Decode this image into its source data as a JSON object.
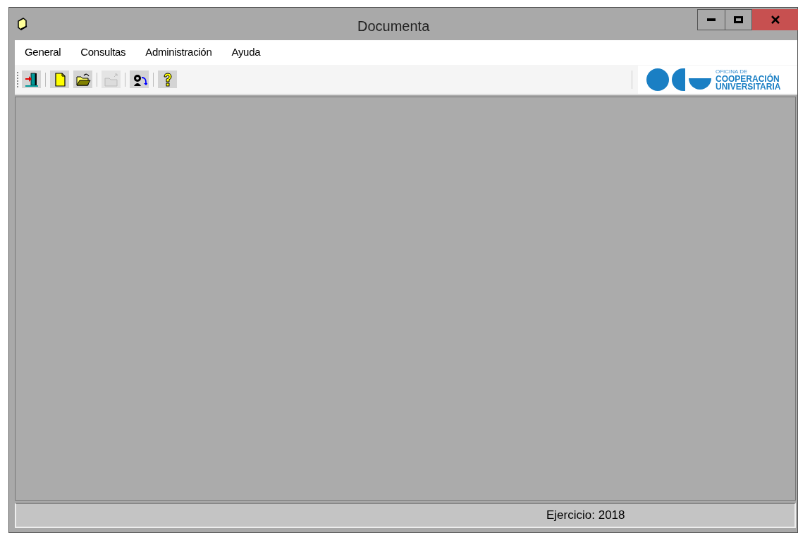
{
  "window": {
    "title": "Documenta"
  },
  "menu": [
    {
      "label": "General"
    },
    {
      "label": "Consultas"
    },
    {
      "label": "Administración"
    },
    {
      "label": "Ayuda"
    }
  ],
  "toolbar": [
    {
      "kind": "exit",
      "disabled": false
    },
    {
      "kind": "sep"
    },
    {
      "kind": "new",
      "disabled": false
    },
    {
      "kind": "open",
      "disabled": false
    },
    {
      "kind": "sep"
    },
    {
      "kind": "close",
      "disabled": true
    },
    {
      "kind": "sep"
    },
    {
      "kind": "users",
      "disabled": false
    },
    {
      "kind": "sep"
    },
    {
      "kind": "help",
      "disabled": false
    }
  ],
  "logo": {
    "lines": [
      "OFICINA DE",
      "COOPERACIÓN",
      "UNIVERSITARIA"
    ]
  },
  "status_bar": {
    "text": "Ejercicio: 2018"
  }
}
